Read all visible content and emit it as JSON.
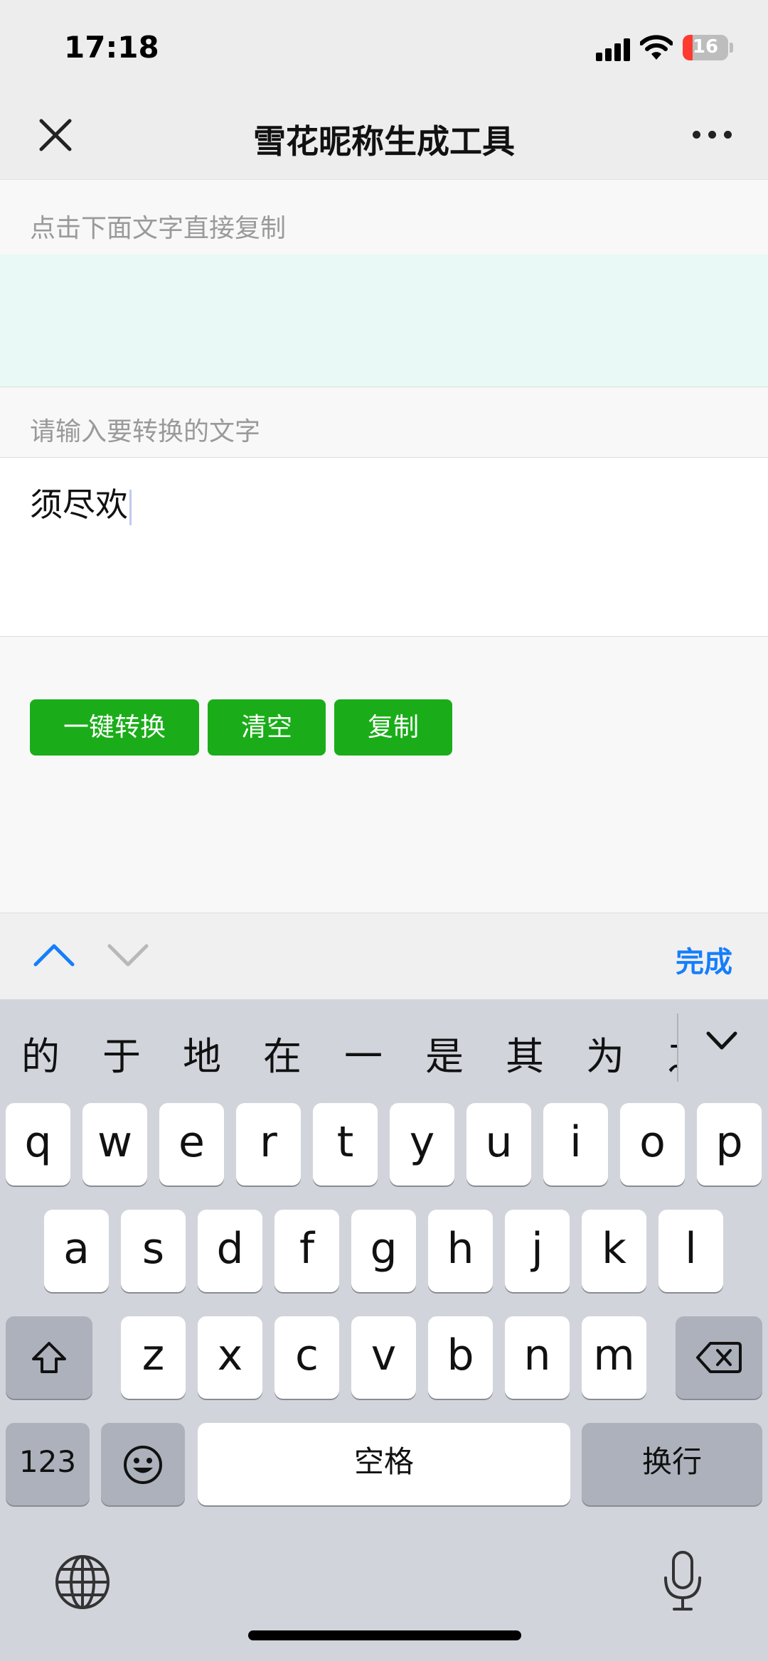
{
  "status_bar": {
    "time": "17:18",
    "battery": "16"
  },
  "nav": {
    "title": "雪花昵称生成工具"
  },
  "output_hint": "点击下面文字直接复制",
  "input_hint": "请输入要转换的文字",
  "input_value": "须尽欢",
  "buttons": {
    "convert": "一键转换",
    "clear": "清空",
    "copy": "复制"
  },
  "accessory": {
    "done": "完成"
  },
  "keyboard": {
    "candidates": [
      "的",
      "于",
      "地",
      "在",
      "一",
      "是",
      "其",
      "为",
      "之"
    ],
    "row1": [
      "q",
      "w",
      "e",
      "r",
      "t",
      "y",
      "u",
      "i",
      "o",
      "p"
    ],
    "row2": [
      "a",
      "s",
      "d",
      "f",
      "g",
      "h",
      "j",
      "k",
      "l"
    ],
    "row3": [
      "z",
      "x",
      "c",
      "v",
      "b",
      "n",
      "m"
    ],
    "numbers": "123",
    "space": "空格",
    "return": "换行"
  },
  "colors": {
    "button_green": "#1aad19",
    "result_bg": "#e9f9f5",
    "link_blue": "#157efb"
  }
}
